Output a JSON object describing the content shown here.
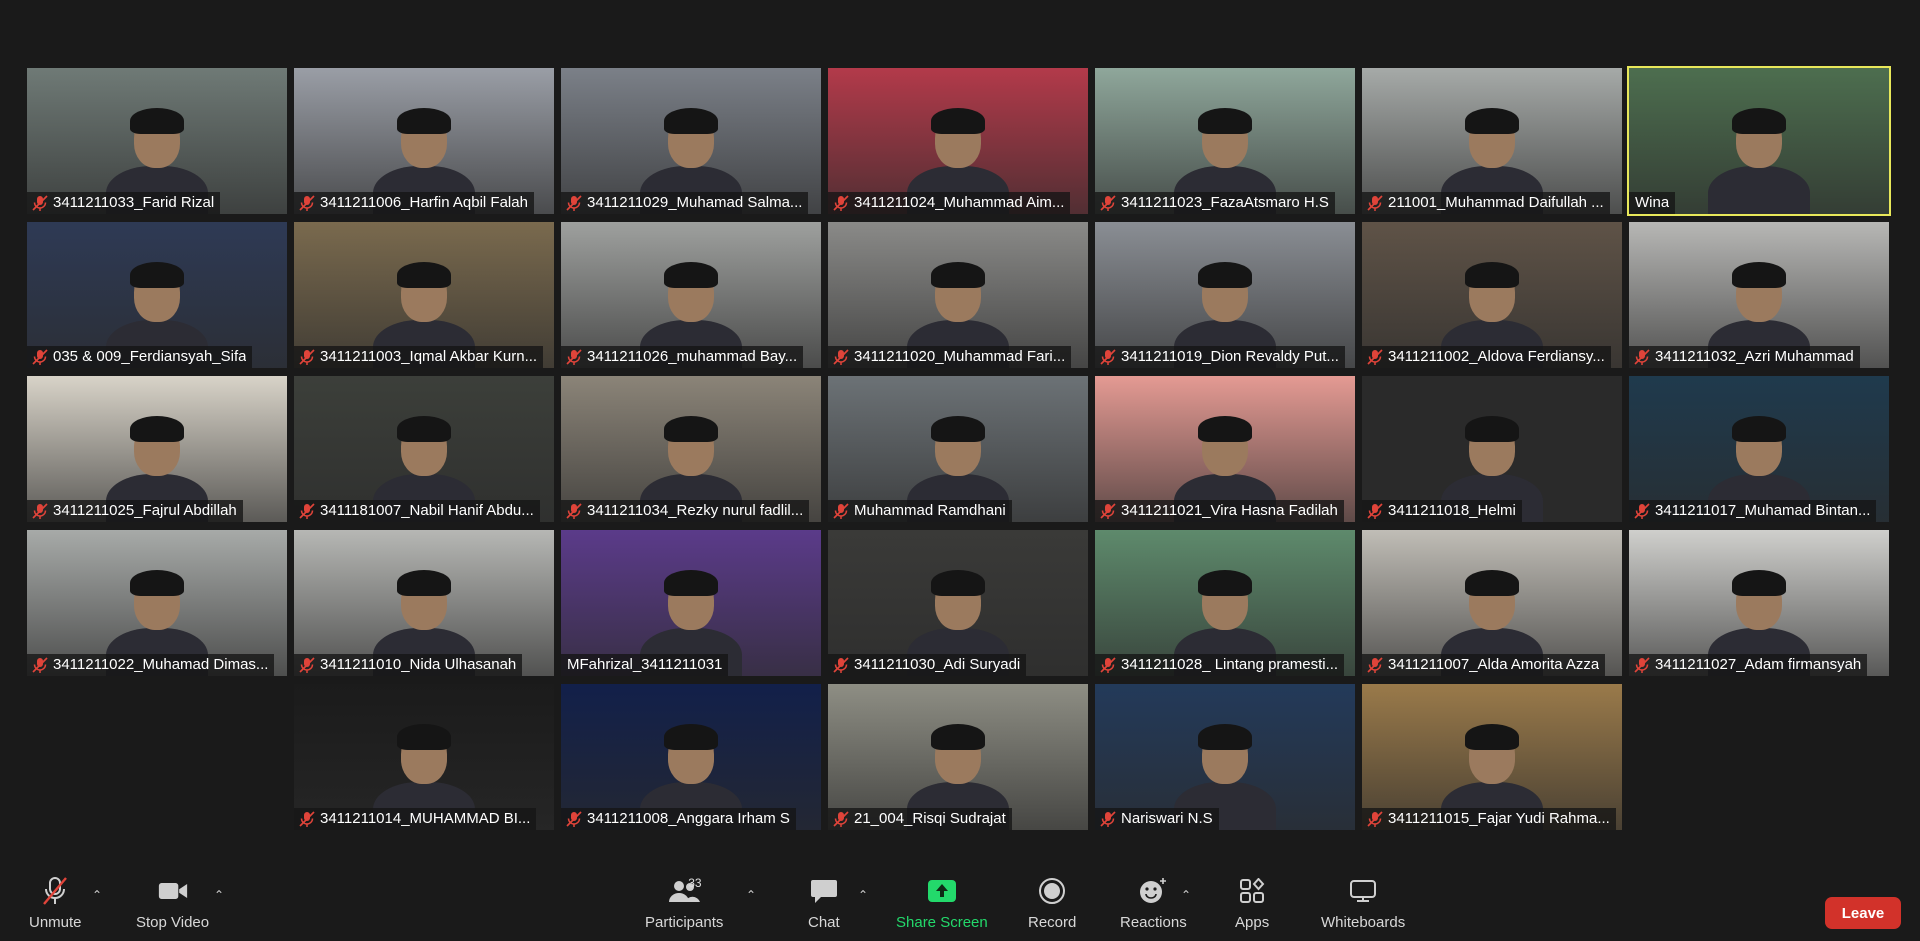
{
  "participants": [
    {
      "name": "3411211033_Farid Rizal",
      "muted": true,
      "bg": "#6f7a76"
    },
    {
      "name": "3411211006_Harfin Aqbil Falah",
      "muted": true,
      "bg": "#9a9ea6"
    },
    {
      "name": "3411211029_Muhamad Salma...",
      "muted": true,
      "bg": "#7b8088"
    },
    {
      "name": "3411211024_Muhammad Aim...",
      "muted": true,
      "bg": "#b33a4a"
    },
    {
      "name": "3411211023_FazaAtsmaro H.S",
      "muted": true,
      "bg": "#8fa79b"
    },
    {
      "name": "211001_Muhammad Daifullah ...",
      "muted": true,
      "bg": "#a6aaa8"
    },
    {
      "name": "Wina",
      "muted": false,
      "active": true,
      "bg": "#4d6e4f"
    },
    {
      "name": "035 & 009_Ferdiansyah_Sifa",
      "muted": true,
      "bg": "#2e3a55"
    },
    {
      "name": "3411211003_Iqmal Akbar Kurn...",
      "muted": true,
      "bg": "#7a6a4e"
    },
    {
      "name": "3411211026_muhammad Bay...",
      "muted": true,
      "bg": "#9ea09e"
    },
    {
      "name": "3411211020_Muhammad Fari...",
      "muted": true,
      "bg": "#8a8a88"
    },
    {
      "name": "3411211019_Dion Revaldy Put...",
      "muted": true,
      "bg": "#8a8e94"
    },
    {
      "name": "3411211002_Aldova Ferdiansy...",
      "muted": true,
      "bg": "#5f5347"
    },
    {
      "name": "3411211032_Azri Muhammad",
      "muted": true,
      "bg": "#b7b7b5"
    },
    {
      "name": "3411211025_Fajrul Abdillah",
      "muted": true,
      "bg": "#d8d3c8"
    },
    {
      "name": "3411181007_Nabil Hanif Abdu...",
      "muted": true,
      "bg": "#3c3f3a"
    },
    {
      "name": "3411211034_Rezky nurul fadlil...",
      "muted": true,
      "bg": "#8b8478"
    },
    {
      "name": "Muhammad Ramdhani",
      "muted": true,
      "bg": "#6c7276"
    },
    {
      "name": "3411211021_Vira Hasna Fadilah",
      "muted": true,
      "bg": "#e49a93"
    },
    {
      "name": "3411211018_Helmi",
      "muted": true,
      "bg": "#2a2a2a"
    },
    {
      "name": "3411211017_Muhamad Bintan...",
      "muted": true,
      "bg": "#1f3a4d"
    },
    {
      "name": "3411211022_Muhamad Dimas...",
      "muted": true,
      "bg": "#a7aaa8"
    },
    {
      "name": "3411211010_Nida Ulhasanah",
      "muted": true,
      "bg": "#b6b7b4"
    },
    {
      "name": "MFahrizal_3411211031",
      "muted": false,
      "bg": "#5b3b8a"
    },
    {
      "name": "3411211030_Adi Suryadi",
      "muted": true,
      "bg": "#3a3a38"
    },
    {
      "name": "3411211028_ Lintang pramesti...",
      "muted": true,
      "bg": "#5e8a6c"
    },
    {
      "name": "3411211007_Alda Amorita Azza",
      "muted": true,
      "bg": "#c0bdb6"
    },
    {
      "name": "3411211027_Adam firmansyah",
      "muted": true,
      "bg": "#cfcfcc"
    },
    {
      "name": "3411211014_MUHAMMAD BI...",
      "muted": true,
      "bg": "#1b1b1b"
    },
    {
      "name": "3411211008_Anggara Irham S",
      "muted": true,
      "bg": "#12204a"
    },
    {
      "name": "21_004_Risqi Sudrajat",
      "muted": true,
      "bg": "#8e8e84"
    },
    {
      "name": "Nariswari N.S",
      "muted": true,
      "bg": "#233a5a"
    },
    {
      "name": "3411211015_Fajar Yudi Rahma...",
      "muted": true,
      "bg": "#9a7a4a"
    }
  ],
  "toolbar": {
    "unmute": "Unmute",
    "stop_video": "Stop Video",
    "participants": "Participants",
    "participants_count": "33",
    "chat": "Chat",
    "share_screen": "Share Screen",
    "record": "Record",
    "reactions": "Reactions",
    "apps": "Apps",
    "whiteboards": "Whiteboards",
    "leave": "Leave"
  },
  "colors": {
    "leave": "#d2322a",
    "share": "#23d96b",
    "active_speaker": "#e8e85a"
  }
}
